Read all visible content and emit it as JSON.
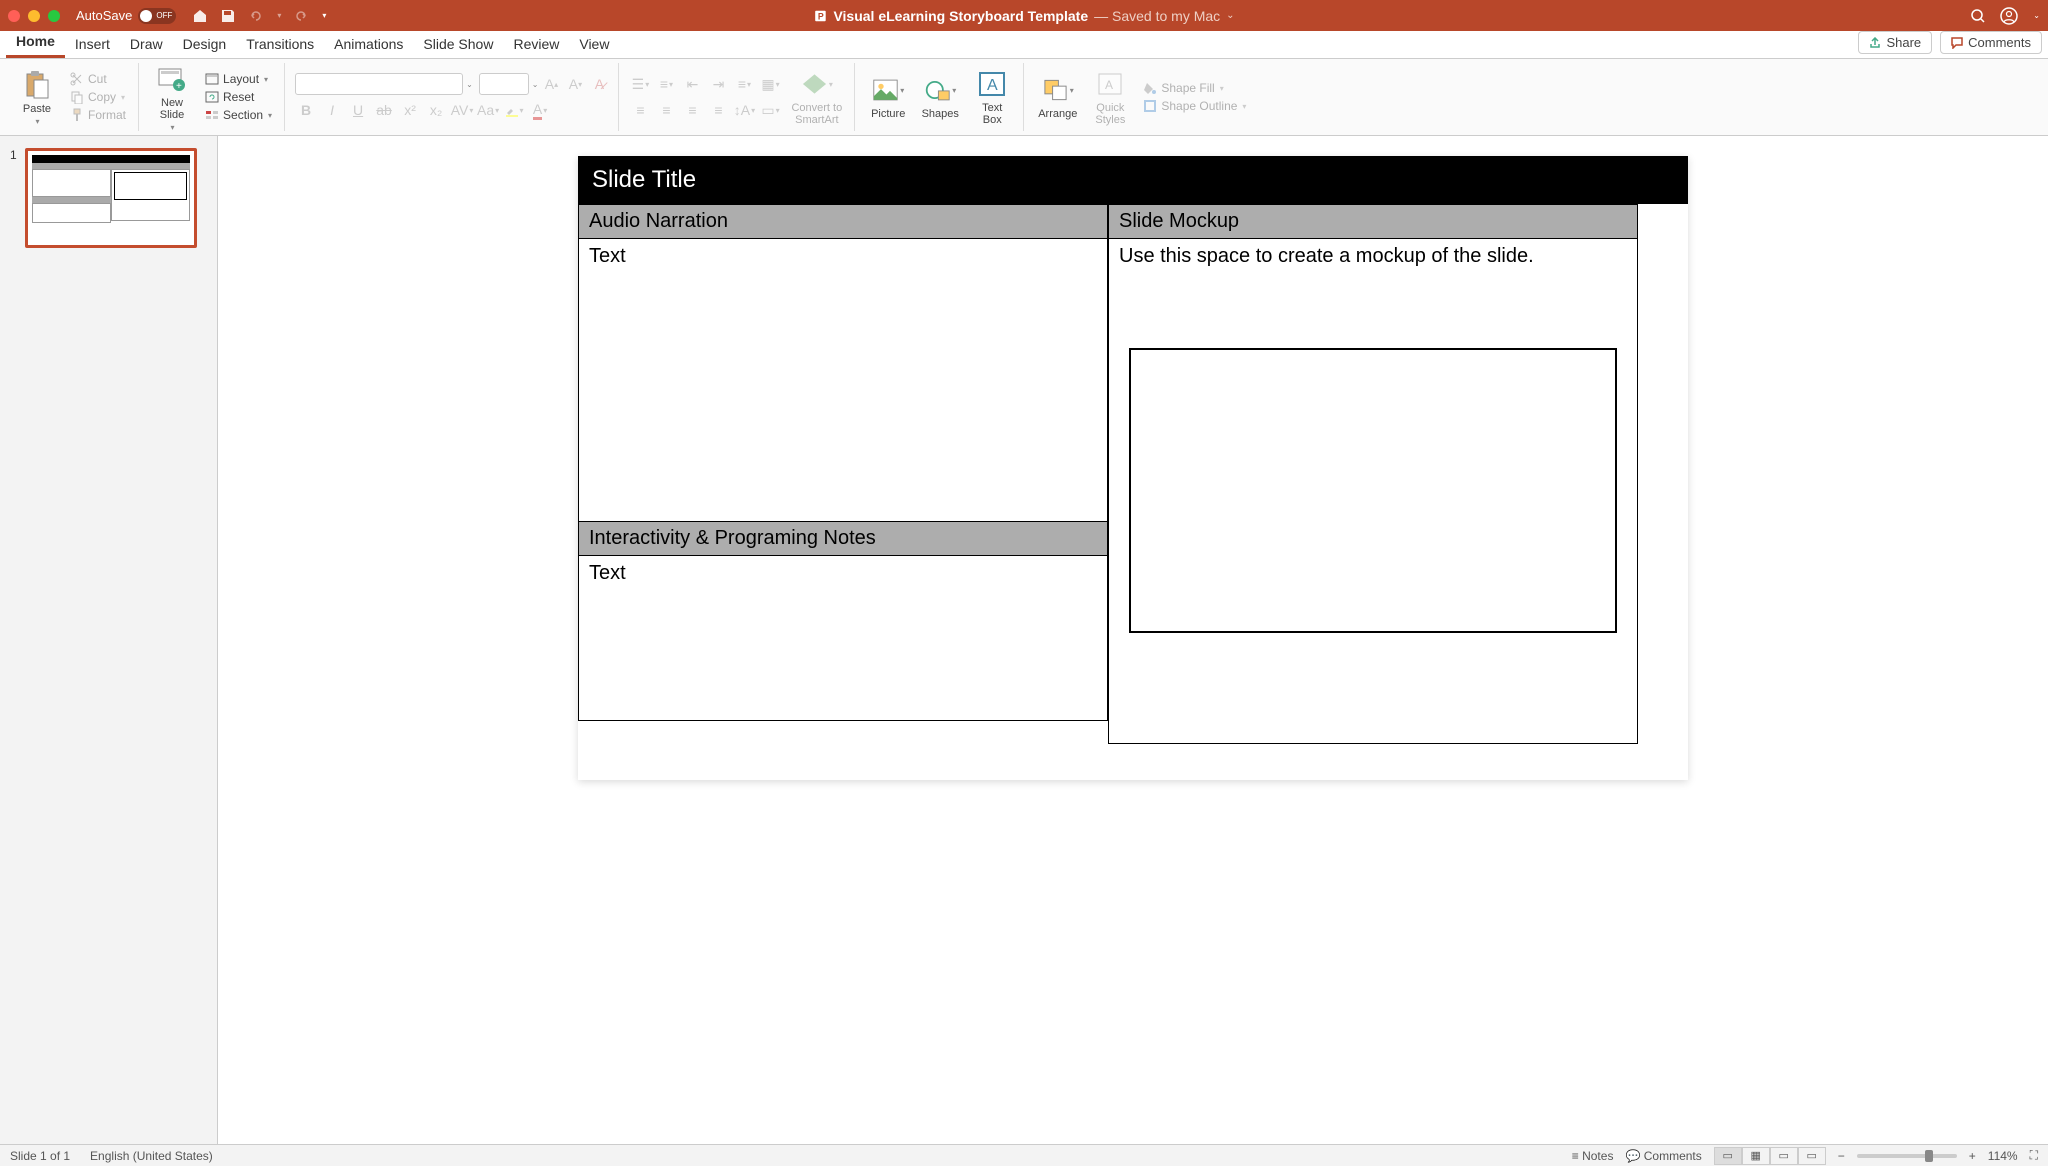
{
  "titlebar": {
    "autosave_label": "AutoSave",
    "autosave_state": "OFF",
    "doc_title": "Visual eLearning Storyboard Template",
    "save_status": "— Saved to my Mac"
  },
  "tabs": {
    "items": [
      "Home",
      "Insert",
      "Draw",
      "Design",
      "Transitions",
      "Animations",
      "Slide Show",
      "Review",
      "View"
    ],
    "active_index": 0,
    "share": "Share",
    "comments": "Comments"
  },
  "ribbon": {
    "paste": "Paste",
    "cut": "Cut",
    "copy": "Copy",
    "format": "Format",
    "new_slide": "New\nSlide",
    "layout": "Layout",
    "reset": "Reset",
    "section": "Section",
    "convert_smartart": "Convert to\nSmartArt",
    "picture": "Picture",
    "shapes": "Shapes",
    "text_box": "Text\nBox",
    "arrange": "Arrange",
    "quick_styles": "Quick\nStyles",
    "shape_fill": "Shape Fill",
    "shape_outline": "Shape Outline"
  },
  "thumbs": {
    "num": "1"
  },
  "slide": {
    "title": "Slide Title",
    "audio_hdr": "Audio Narration",
    "audio_text": "Text",
    "mockup_hdr": "Slide Mockup",
    "mockup_text": "Use this space to create a mockup of the slide.",
    "interact_hdr": "Interactivity & Programing Notes",
    "interact_text": "Text"
  },
  "statusbar": {
    "slide_info": "Slide 1 of 1",
    "language": "English (United States)",
    "notes": "Notes",
    "comments": "Comments",
    "zoom": "114%"
  }
}
